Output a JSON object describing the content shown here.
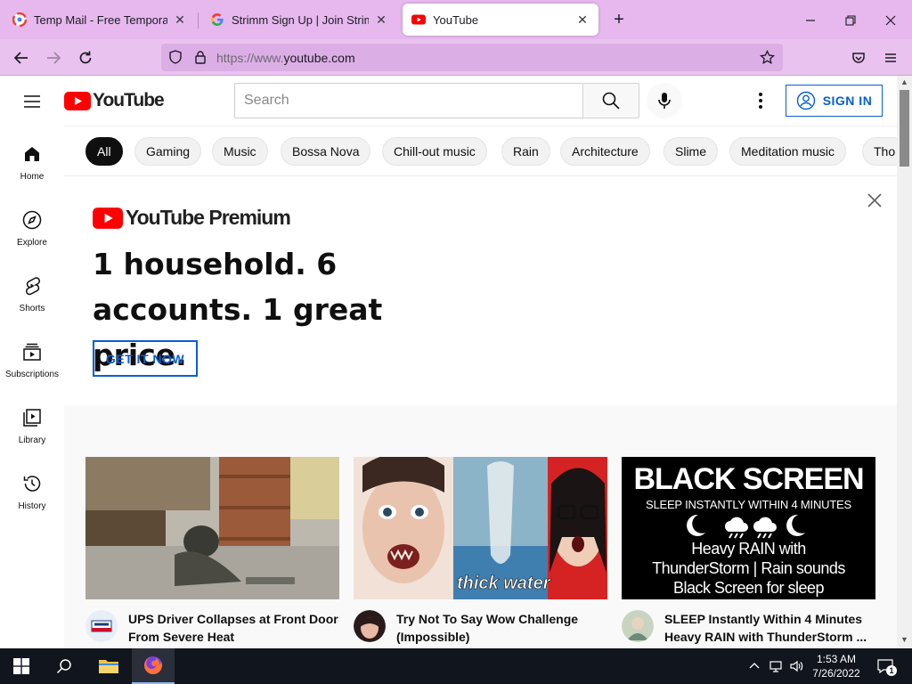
{
  "browser": {
    "tabs": [
      {
        "title": "Temp Mail - Free Temporary Email",
        "icon": "gmail-favicon"
      },
      {
        "title": "Strimm Sign Up | Join Strimm",
        "icon": "google-favicon"
      },
      {
        "title": "YouTube",
        "icon": "youtube-favicon",
        "active": true
      }
    ],
    "url_scheme": "https://www.",
    "url_host": "youtube.com"
  },
  "header": {
    "logo_text": "YouTube",
    "search_placeholder": "Search",
    "signin_label": "SIGN IN"
  },
  "guide": {
    "items": [
      {
        "label": "Home",
        "icon": "home-icon"
      },
      {
        "label": "Explore",
        "icon": "compass-icon"
      },
      {
        "label": "Shorts",
        "icon": "shorts-icon"
      },
      {
        "label": "Subscriptions",
        "icon": "subscriptions-icon"
      },
      {
        "label": "Library",
        "icon": "library-icon"
      },
      {
        "label": "History",
        "icon": "history-icon"
      }
    ]
  },
  "chips": [
    "All",
    "Gaming",
    "Music",
    "Bossa Nova",
    "Chill-out music",
    "Rain",
    "Architecture",
    "Slime",
    "Meditation music",
    "Tho"
  ],
  "promo": {
    "logo_text": "YouTube Premium",
    "headline": "1 household. 6 accounts. 1 great price.",
    "cta": "GET IT NOW"
  },
  "videos": [
    {
      "title": "UPS Driver Collapses at Front Door From Severe Heat",
      "channel_badge": "INSIDE EDITION"
    },
    {
      "title": "Try Not To Say Wow Challenge (Impossible)",
      "thumb_caption": "thick water"
    },
    {
      "title": "SLEEP Instantly Within 4 Minutes Heavy RAIN with ThunderStorm ...",
      "thumb_heading": "BLACK SCREEN",
      "thumb_sub": "SLEEP INSTANTLY WITHIN 4 MINUTES",
      "thumb_l1": "Heavy RAIN with",
      "thumb_l2": "ThunderStorm | Rain sounds",
      "thumb_l3": "Black Screen for sleep"
    }
  ],
  "taskbar": {
    "time": "1:53 AM",
    "date": "7/26/2022",
    "notification_count": "1"
  },
  "colors": {
    "tabbar": "#e6b8ee",
    "youtube_red": "#ff0000",
    "link_blue": "#065fd4"
  }
}
